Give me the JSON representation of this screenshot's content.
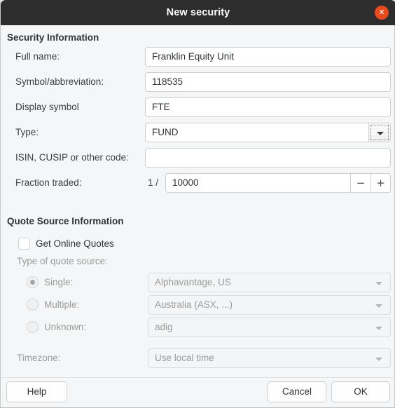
{
  "window": {
    "title": "New security",
    "close_icon": "close-icon",
    "close_glyph": "✕",
    "accent_close_color": "#e8491d",
    "titlebar_color": "#2d2d2d"
  },
  "security_section": {
    "heading": "Security Information",
    "rows": [
      {
        "label": "Full name:",
        "value": "Franklin Equity Unit",
        "placeholder": ""
      },
      {
        "label": "Symbol/abbreviation:",
        "value": "118535",
        "placeholder": ""
      },
      {
        "label": "Display symbol",
        "value": "FTE",
        "placeholder": ""
      },
      {
        "label": "Type:",
        "value": "FUND",
        "placeholder": ""
      },
      {
        "label": "ISIN, CUSIP or other code:",
        "value": "",
        "placeholder": ""
      }
    ],
    "fraction": {
      "label": "Fraction traded:",
      "prefix": "1 /",
      "value": "10000",
      "decrement_label": "−",
      "increment_label": "+"
    }
  },
  "quote_section": {
    "heading": "Quote Source Information",
    "get_online_quotes": {
      "label": "Get Online Quotes",
      "checked": false
    },
    "type_of_quote_source_label": "Type of quote source:",
    "sources": [
      {
        "label": "Single:",
        "value": "Alphavantage, US",
        "selected": true
      },
      {
        "label": "Multiple:",
        "value": "Australia (ASX, ...)",
        "selected": false
      },
      {
        "label": "Unknown:",
        "value": "adig",
        "selected": false
      }
    ],
    "timezone": {
      "label": "Timezone:",
      "value": "Use local time"
    }
  },
  "footer": {
    "help_label": "Help",
    "cancel_label": "Cancel",
    "ok_label": "OK"
  }
}
